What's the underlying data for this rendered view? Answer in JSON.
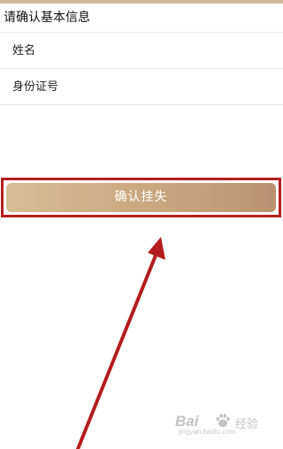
{
  "page": {
    "section_title": "请确认基本信息",
    "confirm_button_label": "确认挂失"
  },
  "form": {
    "fields": [
      {
        "label": "姓名",
        "value": ""
      },
      {
        "label": "身份证号",
        "value": ""
      }
    ]
  },
  "annotation": {
    "arrow_color": "#b31d1d",
    "box_color": "#b51e1e"
  },
  "watermark": {
    "logo_left": "Bai",
    "logo_right": "经验",
    "url": "jingyan.baidu.com"
  },
  "colors": {
    "accent": "#cdb99a",
    "button_start": "#d6bd93",
    "button_end": "#b99371"
  }
}
